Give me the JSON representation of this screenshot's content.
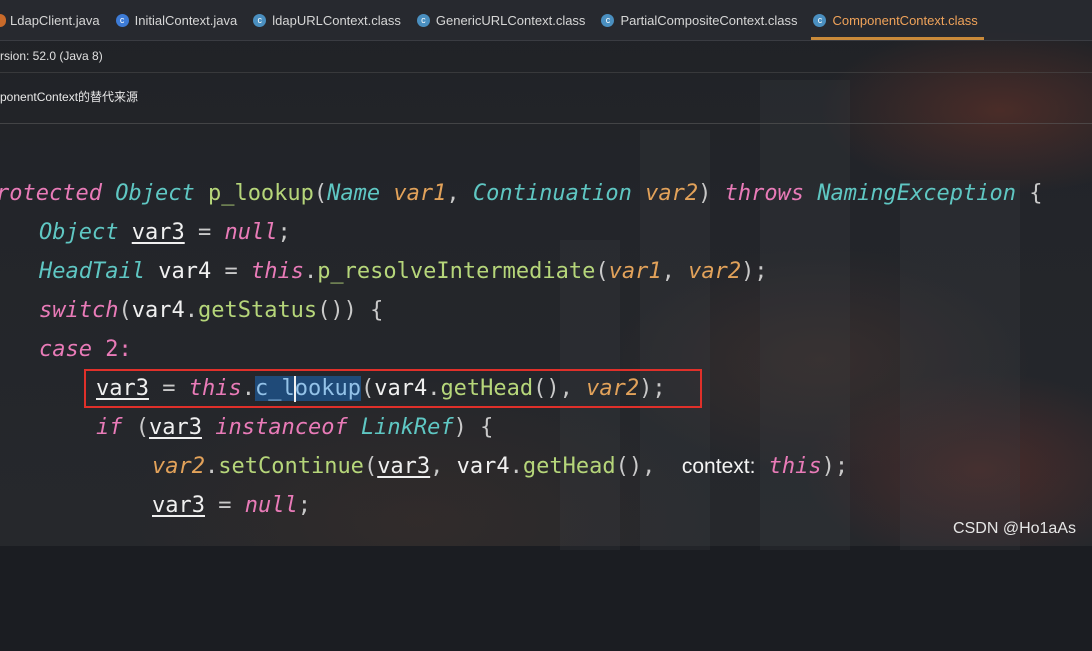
{
  "tabs": [
    {
      "label": "LdapClient.java",
      "icon": "java-file-icon"
    },
    {
      "label": "InitialContext.java",
      "icon": "java-file-icon"
    },
    {
      "label": "ldapURLContext.class",
      "icon": "class-file-icon"
    },
    {
      "label": "GenericURLContext.class",
      "icon": "class-file-icon"
    },
    {
      "label": "PartialCompositeContext.class",
      "icon": "class-file-icon"
    },
    {
      "label": "ComponentContext.class",
      "icon": "class-file-icon",
      "active": true
    }
  ],
  "info": {
    "version": "rsion: 52.0 (Java 8)",
    "source_note": "ponentContext的替代来源"
  },
  "code": {
    "l1": {
      "kw": "rotected",
      "type1": "Object",
      "method": "p_lookup",
      "open": "(",
      "type2": "Name",
      "p1": "var1",
      "comma": ", ",
      "type3": "Continuation",
      "p2": "var2",
      "close": ")",
      "throws": "throws",
      "exc": "NamingException",
      "tail": " {"
    },
    "l2": {
      "type": "Object",
      "var": "var3",
      "eq": " = ",
      "null": "null",
      "semi": ";"
    },
    "l3": {
      "type": "HeadTail",
      "var": "var4",
      "eq": " = ",
      "this": "this",
      "dot": ".",
      "method": "p_resolveIntermediate",
      "open": "(",
      "a1": "var1",
      "comma": ", ",
      "a2": "var2",
      "close": ");"
    },
    "l4": {
      "kw": "switch",
      "open": "(",
      "var": "var4",
      "dot": ".",
      "method": "getStatus",
      "close": "()) {"
    },
    "l5": {
      "kw": "case",
      "num": "2",
      "colon": ":"
    },
    "l6": {
      "var": "var3",
      "eq": " = ",
      "this": "this",
      "dot": ".",
      "m_a": "c_l",
      "m_b": "ookup",
      "open": "(",
      "v4": "var4",
      "dot2": ".",
      "getHead": "getHead",
      "call": "()",
      "comma": ", ",
      "a2": "var2",
      "close": ");"
    },
    "l7": {
      "kw": "if",
      "open": " (",
      "var": "var3",
      "inst": "instanceof",
      "type": "LinkRef",
      "close": ") {"
    },
    "l8": {
      "p": "var2",
      "dot": ".",
      "method": "setContinue",
      "open": "(",
      "v3": "var3",
      "comma": ", ",
      "v4": "var4",
      "dot2": ".",
      "getHead": "getHead",
      "call": "(),",
      "hint": "context:",
      "this": "this",
      "close": ");"
    },
    "l9": {
      "var": "var3",
      "eq": " = ",
      "null": "null",
      "semi": ";"
    }
  },
  "watermark": "CSDN @Ho1aAs",
  "colors": {
    "highlight_box": "#e0302a",
    "active_tab": "#f0a35a"
  }
}
